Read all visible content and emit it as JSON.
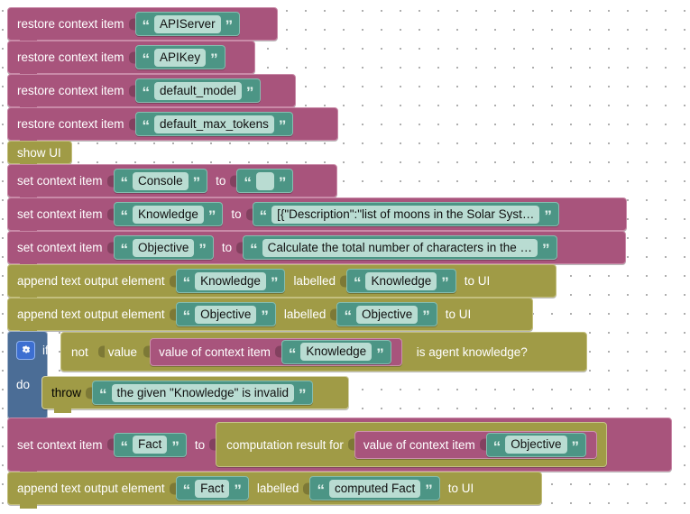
{
  "workspace": {
    "canvas_label": "blockly-workspace",
    "background": "#ffffff",
    "grid_dot_color": "#9a9a9a"
  },
  "palette": {
    "statement_mauve": "#a8547c",
    "statement_olive": "#a09b46",
    "control_blue": "#4b6d96",
    "text_teal": "#4c9585",
    "field_mint": "#b9dcd2",
    "gear_blue": "#3d6fd1"
  },
  "blocks": {
    "restore_1": {
      "label": "restore context item",
      "value": "APIServer"
    },
    "restore_2": {
      "label": "restore context item",
      "value": "APIKey"
    },
    "restore_3": {
      "label": "restore context item",
      "value": "default_model"
    },
    "restore_4": {
      "label": "restore context item",
      "value": "default_max_tokens"
    },
    "show_ui": {
      "label": "show UI"
    },
    "set_console": {
      "label": "set context item",
      "name": "Console",
      "to_label": "to",
      "value": ""
    },
    "set_knowledge": {
      "label": "set context item",
      "name": "Knowledge",
      "to_label": "to",
      "value": "[{\"Description\":\"list of moons in the Solar Syst…"
    },
    "set_objective": {
      "label": "set context item",
      "name": "Objective",
      "to_label": "to",
      "value": "Calculate the total number of characters in the …"
    },
    "append_knowledge": {
      "label": "append text output element",
      "element": "Knowledge",
      "labelled_label": "labelled",
      "label_text": "Knowledge",
      "target_label": "to UI"
    },
    "append_objective": {
      "label": "append text output element",
      "element": "Objective",
      "labelled_label": "labelled",
      "label_text": "Objective",
      "target_label": "to UI"
    },
    "if_block": {
      "gear_icon": "gear-icon",
      "if_label": "if",
      "not_label": "not",
      "value_label": "value",
      "inner_reporter_label": "value of context item",
      "inner_value": "Knowledge",
      "predicate_label": "is agent knowledge?",
      "do_label": "do",
      "throw_label": "throw",
      "throw_value": "the given \"Knowledge\" is invalid"
    },
    "set_fact": {
      "label": "set context item",
      "name": "Fact",
      "to_label": "to",
      "computation_label": "computation result for",
      "inner_reporter_label": "value of context item",
      "inner_value": "Objective"
    },
    "append_fact": {
      "label": "append text output element",
      "element": "Fact",
      "labelled_label": "labelled",
      "label_text": "computed Fact",
      "target_label": "to UI"
    }
  }
}
